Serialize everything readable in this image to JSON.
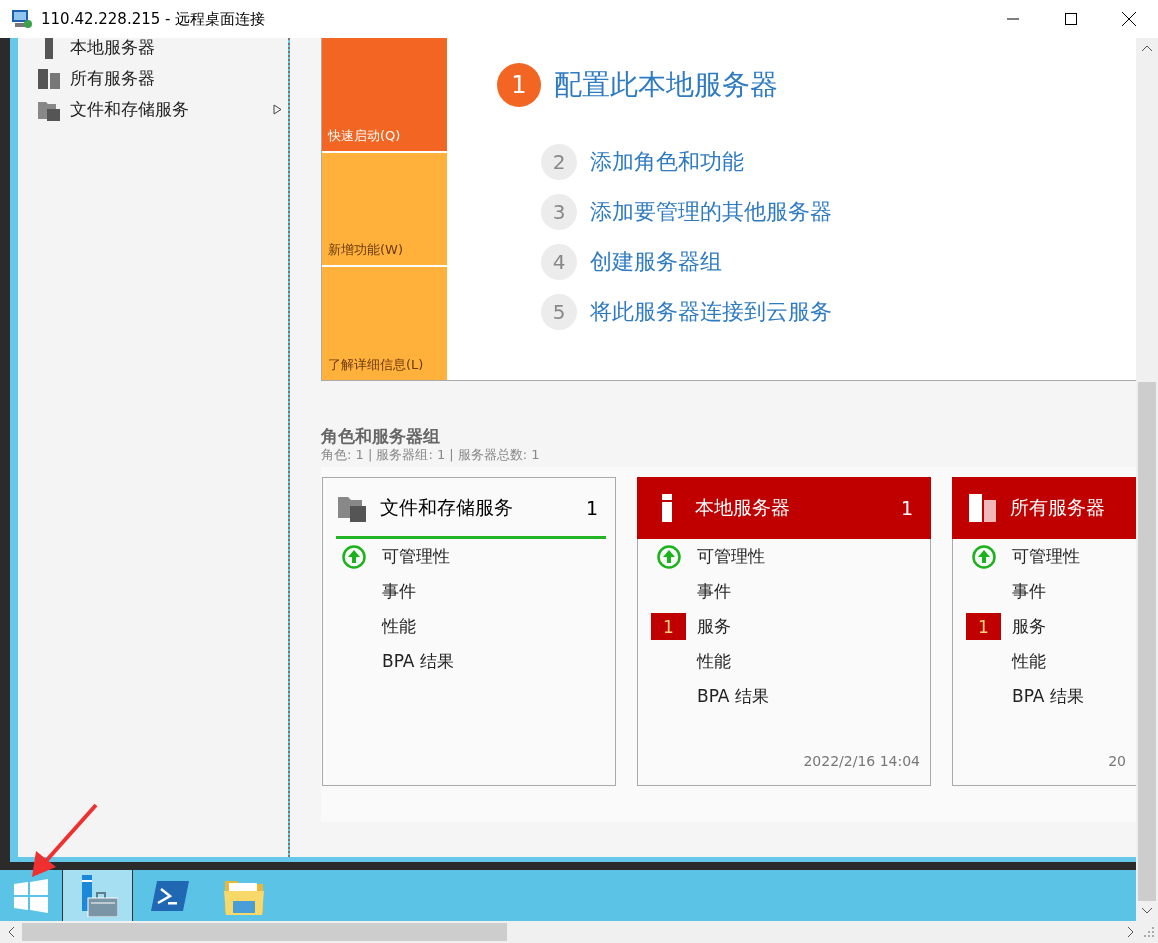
{
  "window": {
    "title": "110.42.228.215 - 远程桌面连接"
  },
  "sidebar": {
    "items": [
      {
        "label": "本地服务器",
        "kind": "server",
        "expandable": false
      },
      {
        "label": "所有服务器",
        "kind": "servers",
        "expandable": false
      },
      {
        "label": "文件和存储服务",
        "kind": "folder",
        "expandable": true
      }
    ]
  },
  "quick_start": {
    "tiles": [
      {
        "label": "快速启动(Q)",
        "selected": true
      },
      {
        "label": "新增功能(W)",
        "selected": false
      },
      {
        "label": "了解详细信息(L)",
        "selected": false
      }
    ]
  },
  "steps": [
    {
      "number": "1",
      "label": "配置此本地服务器",
      "current": true
    },
    {
      "number": "2",
      "label": "添加角色和功能",
      "current": false
    },
    {
      "number": "3",
      "label": "添加要管理的其他服务器",
      "current": false
    },
    {
      "number": "4",
      "label": "创建服务器组",
      "current": false
    },
    {
      "number": "5",
      "label": "将此服务器连接到云服务",
      "current": false
    }
  ],
  "roles_section": {
    "title": "角色和服务器组",
    "summary": "角色: 1 | 服务器组: 1 | 服务器总数: 1"
  },
  "cards": [
    {
      "title": "文件和存储服务",
      "count": "1",
      "kind": "folder",
      "alert": false,
      "rows": [
        {
          "label": "可管理性",
          "healthy": true
        },
        {
          "label": "事件"
        },
        {
          "label": "性能"
        },
        {
          "label": "BPA 结果"
        }
      ]
    },
    {
      "title": "本地服务器",
      "count": "1",
      "kind": "server",
      "alert": true,
      "timestamp": "2022/2/16 14:04",
      "rows": [
        {
          "label": "可管理性",
          "healthy": true
        },
        {
          "label": "事件"
        },
        {
          "label": "服务",
          "badge": "1"
        },
        {
          "label": "性能"
        },
        {
          "label": "BPA 结果"
        }
      ]
    },
    {
      "title": "所有服务器",
      "kind": "servers",
      "alert": true,
      "timestamp": "20",
      "rows": [
        {
          "label": "可管理性",
          "healthy": true
        },
        {
          "label": "事件"
        },
        {
          "label": "服务",
          "badge": "1"
        },
        {
          "label": "性能"
        },
        {
          "label": "BPA 结果"
        }
      ]
    }
  ],
  "taskbar": {
    "items": [
      {
        "kind": "start",
        "selected": false
      },
      {
        "kind": "server_manager",
        "selected": true
      },
      {
        "kind": "powershell",
        "selected": false
      },
      {
        "kind": "explorer",
        "selected": false
      }
    ]
  }
}
